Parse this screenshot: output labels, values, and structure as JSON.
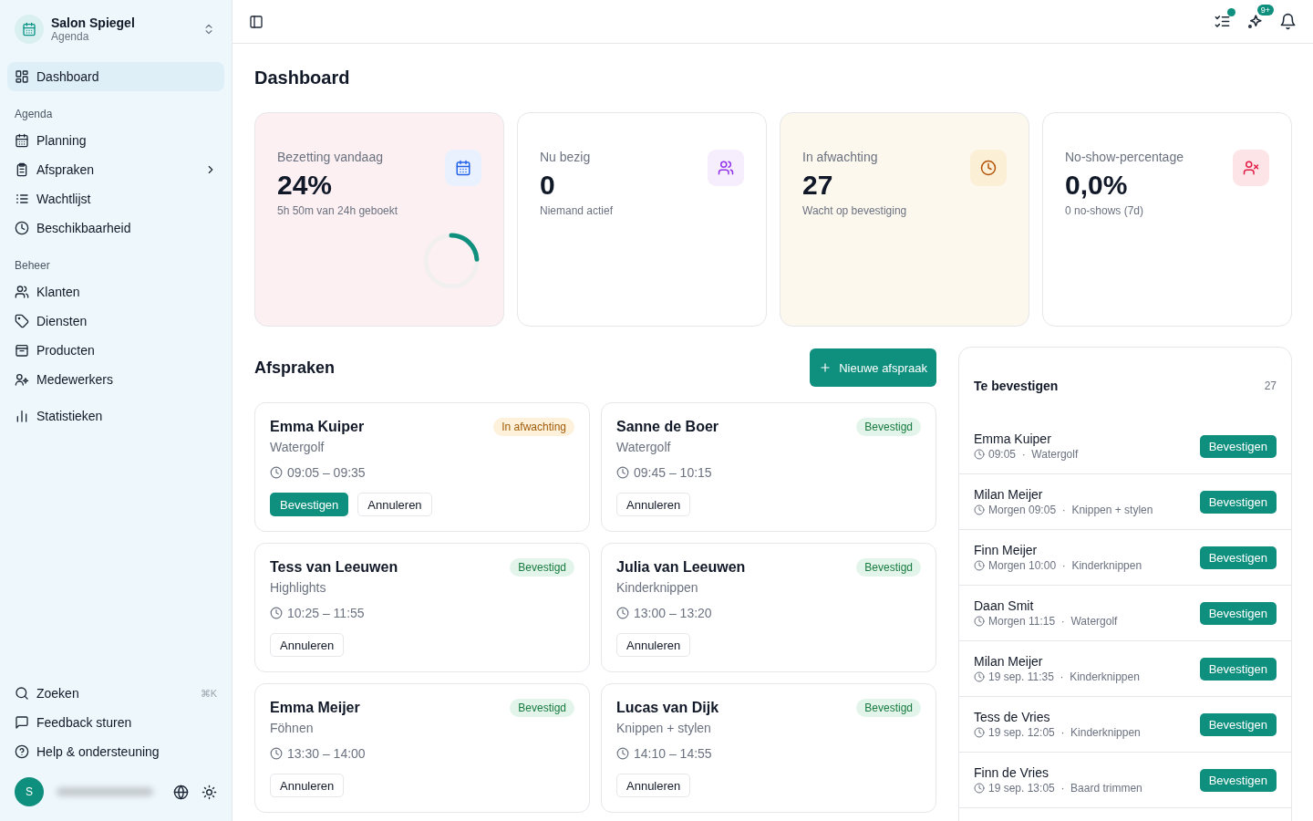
{
  "workspace": {
    "name": "Salon Spiegel",
    "subtitle": "Agenda"
  },
  "nav_main": [
    {
      "label": "Dashboard",
      "kind": "dashboard",
      "selected": true,
      "expandable": false
    }
  ],
  "nav_sections": [
    {
      "title": "Agenda",
      "items": [
        {
          "label": "Planning",
          "kind": "calendar",
          "selected": false,
          "expandable": false
        },
        {
          "label": "Afspraken",
          "kind": "clipboard",
          "selected": false,
          "expandable": true
        },
        {
          "label": "Wachtlijst",
          "kind": "list",
          "selected": false,
          "expandable": false
        },
        {
          "label": "Beschikbaarheid",
          "kind": "clock",
          "selected": false,
          "expandable": false
        }
      ]
    },
    {
      "title": "Beheer",
      "items": [
        {
          "label": "Klanten",
          "kind": "users",
          "selected": false,
          "expandable": false
        },
        {
          "label": "Diensten",
          "kind": "tag",
          "selected": false,
          "expandable": false
        },
        {
          "label": "Producten",
          "kind": "box",
          "selected": false,
          "expandable": false
        },
        {
          "label": "Medewerkers",
          "kind": "staff",
          "selected": false,
          "expandable": false
        }
      ]
    }
  ],
  "nav_extra": [
    {
      "label": "Statistieken",
      "kind": "chart",
      "selected": false,
      "expandable": false
    }
  ],
  "nav_footer": [
    {
      "label": "Zoeken",
      "kind": "search",
      "shortcut": "⌘K"
    },
    {
      "label": "Feedback sturen",
      "kind": "message"
    },
    {
      "label": "Help & ondersteuning",
      "kind": "help"
    }
  ],
  "user": {
    "initial": "S"
  },
  "topbar": {
    "tasks_dot": true,
    "updates_badge": "9+"
  },
  "page_title": "Dashboard",
  "stats": [
    {
      "kind": "occupancy",
      "label": "Bezetting vandaag",
      "value": "24%",
      "note": "5h 50m van 24h geboekt",
      "level": 0.24
    },
    {
      "kind": "active",
      "label": "Nu bezig",
      "value": "0",
      "note": "Niemand actief"
    },
    {
      "kind": "pending",
      "label": "In afwachting",
      "value": "27",
      "note": "Wacht op bevestiging"
    },
    {
      "kind": "noshow",
      "label": "No-show-percentage",
      "value": "0,0%",
      "note": "0 no-shows (7d)"
    }
  ],
  "appointments": {
    "title": "Afspraken",
    "new_button": "Nieuwe afspraak",
    "items": [
      {
        "name": "Emma Kuiper",
        "service": "Watergolf",
        "time": "09:05 – 09:35",
        "status": "In afwachting",
        "kind": "pending",
        "actions": [
          "Bevestigen",
          "Annuleren"
        ]
      },
      {
        "name": "Sanne de Boer",
        "service": "Watergolf",
        "time": "09:45 – 10:15",
        "status": "Bevestigd",
        "kind": "confirmed",
        "actions": [
          "Annuleren"
        ]
      },
      {
        "name": "Tess van Leeuwen",
        "service": "Highlights",
        "time": "10:25 – 11:55",
        "status": "Bevestigd",
        "kind": "confirmed",
        "actions": [
          "Annuleren"
        ]
      },
      {
        "name": "Julia van Leeuwen",
        "service": "Kinderknippen",
        "time": "13:00 – 13:20",
        "status": "Bevestigd",
        "kind": "confirmed",
        "actions": [
          "Annuleren"
        ]
      },
      {
        "name": "Emma Meijer",
        "service": "Föhnen",
        "time": "13:30 – 14:00",
        "status": "Bevestigd",
        "kind": "confirmed",
        "actions": [
          "Annuleren"
        ]
      },
      {
        "name": "Lucas van Dijk",
        "service": "Knippen + stylen",
        "time": "14:10 – 14:55",
        "status": "Bevestigd",
        "kind": "confirmed",
        "actions": [
          "Annuleren"
        ]
      }
    ]
  },
  "to_confirm": {
    "title": "Te bevestigen",
    "count": "27",
    "items": [
      {
        "name": "Emma Kuiper",
        "meta": "09:05  ·  Watergolf",
        "button": "Bevestigen"
      },
      {
        "name": "Milan Meijer",
        "meta": "Morgen 09:05  ·  Knippen + stylen",
        "button": "Bevestigen"
      },
      {
        "name": "Finn Meijer",
        "meta": "Morgen 10:00  ·  Kinderknippen",
        "button": "Bevestigen"
      },
      {
        "name": "Daan Smit",
        "meta": "Morgen 11:15  ·  Watergolf",
        "button": "Bevestigen"
      },
      {
        "name": "Milan Meijer",
        "meta": "19 sep. 11:35  ·  Kinderknippen",
        "button": "Bevestigen"
      },
      {
        "name": "Tess de Vries",
        "meta": "19 sep. 12:05  ·  Kinderknippen",
        "button": "Bevestigen"
      },
      {
        "name": "Finn de Vries",
        "meta": "19 sep. 13:05  ·  Baard trimmen",
        "button": "Bevestigen"
      }
    ]
  }
}
